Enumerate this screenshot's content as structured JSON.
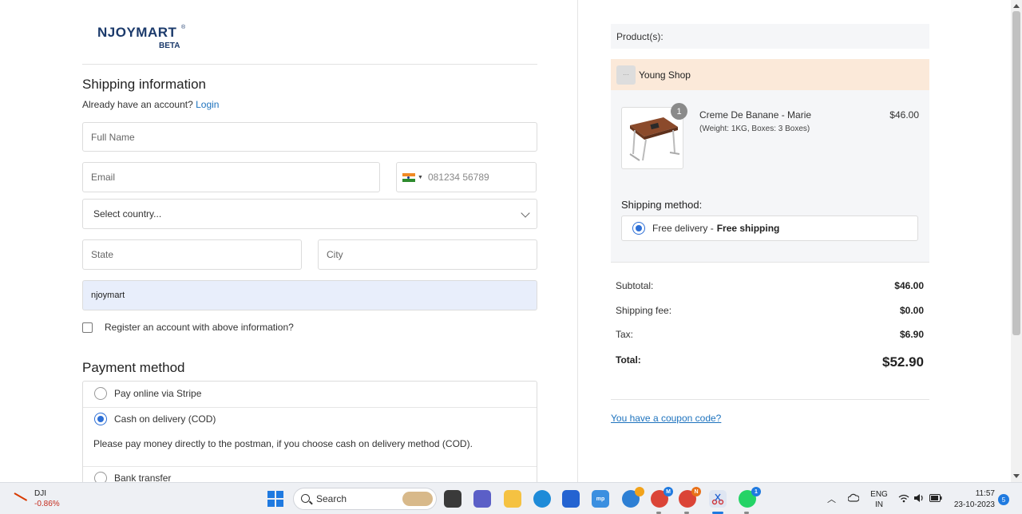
{
  "brand": {
    "name": "NJOYMART",
    "reg": "®",
    "tag": "BETA"
  },
  "shipping": {
    "heading": "Shipping information",
    "account_prompt": "Already have an account?",
    "login_label": "Login",
    "full_name_placeholder": "Full Name",
    "email_placeholder": "Email",
    "phone_placeholder": "081234 56789",
    "country_placeholder": "Select country...",
    "state_placeholder": "State",
    "city_placeholder": "City",
    "autofill_value": "njoymart",
    "register_label": "Register an account with above information?"
  },
  "payment": {
    "heading": "Payment method",
    "options": [
      {
        "label": "Pay online via Stripe",
        "selected": false
      },
      {
        "label": "Cash on delivery (COD)",
        "selected": true
      },
      {
        "label": "Bank transfer",
        "selected": false
      }
    ],
    "cod_note": "Please pay money directly to the postman, if you choose cash on delivery method (COD)."
  },
  "cart": {
    "products_label": "Product(s):",
    "shop_name": "Young Shop",
    "item": {
      "quantity": "1",
      "name": "Creme De Banane - Marie",
      "meta": "(Weight: 1KG, Boxes: 3 Boxes)",
      "price": "$46.00"
    },
    "shipping_method_label": "Shipping method:",
    "shipping_option": {
      "name": "Free delivery -",
      "detail": "Free shipping",
      "selected": true
    },
    "summary": {
      "subtotal_label": "Subtotal:",
      "subtotal": "$46.00",
      "shipping_fee_label": "Shipping fee:",
      "shipping_fee": "$0.00",
      "tax_label": "Tax:",
      "tax": "$6.90",
      "total_label": "Total:",
      "total": "$52.90"
    },
    "coupon_link": "You have a coupon code?"
  },
  "taskbar": {
    "stock": {
      "symbol": "DJI",
      "change": "-0.86%"
    },
    "search_label": "Search",
    "language": {
      "lang": "ENG",
      "region": "IN"
    },
    "time": "11:57",
    "date": "23-10-2023",
    "notification_count": "5",
    "whatsapp_badge": "1",
    "accent": "#1f7ae0"
  }
}
